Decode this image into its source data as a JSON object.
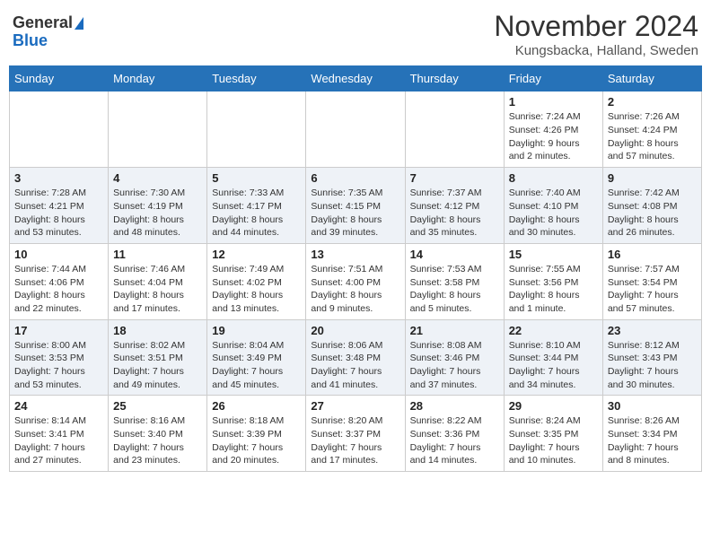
{
  "logo": {
    "general": "General",
    "blue": "Blue"
  },
  "title": "November 2024",
  "subtitle": "Kungsbacka, Halland, Sweden",
  "days_of_week": [
    "Sunday",
    "Monday",
    "Tuesday",
    "Wednesday",
    "Thursday",
    "Friday",
    "Saturday"
  ],
  "weeks": [
    [
      {
        "day": "",
        "info": ""
      },
      {
        "day": "",
        "info": ""
      },
      {
        "day": "",
        "info": ""
      },
      {
        "day": "",
        "info": ""
      },
      {
        "day": "",
        "info": ""
      },
      {
        "day": "1",
        "info": "Sunrise: 7:24 AM\nSunset: 4:26 PM\nDaylight: 9 hours and 2 minutes."
      },
      {
        "day": "2",
        "info": "Sunrise: 7:26 AM\nSunset: 4:24 PM\nDaylight: 8 hours and 57 minutes."
      }
    ],
    [
      {
        "day": "3",
        "info": "Sunrise: 7:28 AM\nSunset: 4:21 PM\nDaylight: 8 hours and 53 minutes."
      },
      {
        "day": "4",
        "info": "Sunrise: 7:30 AM\nSunset: 4:19 PM\nDaylight: 8 hours and 48 minutes."
      },
      {
        "day": "5",
        "info": "Sunrise: 7:33 AM\nSunset: 4:17 PM\nDaylight: 8 hours and 44 minutes."
      },
      {
        "day": "6",
        "info": "Sunrise: 7:35 AM\nSunset: 4:15 PM\nDaylight: 8 hours and 39 minutes."
      },
      {
        "day": "7",
        "info": "Sunrise: 7:37 AM\nSunset: 4:12 PM\nDaylight: 8 hours and 35 minutes."
      },
      {
        "day": "8",
        "info": "Sunrise: 7:40 AM\nSunset: 4:10 PM\nDaylight: 8 hours and 30 minutes."
      },
      {
        "day": "9",
        "info": "Sunrise: 7:42 AM\nSunset: 4:08 PM\nDaylight: 8 hours and 26 minutes."
      }
    ],
    [
      {
        "day": "10",
        "info": "Sunrise: 7:44 AM\nSunset: 4:06 PM\nDaylight: 8 hours and 22 minutes."
      },
      {
        "day": "11",
        "info": "Sunrise: 7:46 AM\nSunset: 4:04 PM\nDaylight: 8 hours and 17 minutes."
      },
      {
        "day": "12",
        "info": "Sunrise: 7:49 AM\nSunset: 4:02 PM\nDaylight: 8 hours and 13 minutes."
      },
      {
        "day": "13",
        "info": "Sunrise: 7:51 AM\nSunset: 4:00 PM\nDaylight: 8 hours and 9 minutes."
      },
      {
        "day": "14",
        "info": "Sunrise: 7:53 AM\nSunset: 3:58 PM\nDaylight: 8 hours and 5 minutes."
      },
      {
        "day": "15",
        "info": "Sunrise: 7:55 AM\nSunset: 3:56 PM\nDaylight: 8 hours and 1 minute."
      },
      {
        "day": "16",
        "info": "Sunrise: 7:57 AM\nSunset: 3:54 PM\nDaylight: 7 hours and 57 minutes."
      }
    ],
    [
      {
        "day": "17",
        "info": "Sunrise: 8:00 AM\nSunset: 3:53 PM\nDaylight: 7 hours and 53 minutes."
      },
      {
        "day": "18",
        "info": "Sunrise: 8:02 AM\nSunset: 3:51 PM\nDaylight: 7 hours and 49 minutes."
      },
      {
        "day": "19",
        "info": "Sunrise: 8:04 AM\nSunset: 3:49 PM\nDaylight: 7 hours and 45 minutes."
      },
      {
        "day": "20",
        "info": "Sunrise: 8:06 AM\nSunset: 3:48 PM\nDaylight: 7 hours and 41 minutes."
      },
      {
        "day": "21",
        "info": "Sunrise: 8:08 AM\nSunset: 3:46 PM\nDaylight: 7 hours and 37 minutes."
      },
      {
        "day": "22",
        "info": "Sunrise: 8:10 AM\nSunset: 3:44 PM\nDaylight: 7 hours and 34 minutes."
      },
      {
        "day": "23",
        "info": "Sunrise: 8:12 AM\nSunset: 3:43 PM\nDaylight: 7 hours and 30 minutes."
      }
    ],
    [
      {
        "day": "24",
        "info": "Sunrise: 8:14 AM\nSunset: 3:41 PM\nDaylight: 7 hours and 27 minutes."
      },
      {
        "day": "25",
        "info": "Sunrise: 8:16 AM\nSunset: 3:40 PM\nDaylight: 7 hours and 23 minutes."
      },
      {
        "day": "26",
        "info": "Sunrise: 8:18 AM\nSunset: 3:39 PM\nDaylight: 7 hours and 20 minutes."
      },
      {
        "day": "27",
        "info": "Sunrise: 8:20 AM\nSunset: 3:37 PM\nDaylight: 7 hours and 17 minutes."
      },
      {
        "day": "28",
        "info": "Sunrise: 8:22 AM\nSunset: 3:36 PM\nDaylight: 7 hours and 14 minutes."
      },
      {
        "day": "29",
        "info": "Sunrise: 8:24 AM\nSunset: 3:35 PM\nDaylight: 7 hours and 10 minutes."
      },
      {
        "day": "30",
        "info": "Sunrise: 8:26 AM\nSunset: 3:34 PM\nDaylight: 7 hours and 8 minutes."
      }
    ]
  ]
}
